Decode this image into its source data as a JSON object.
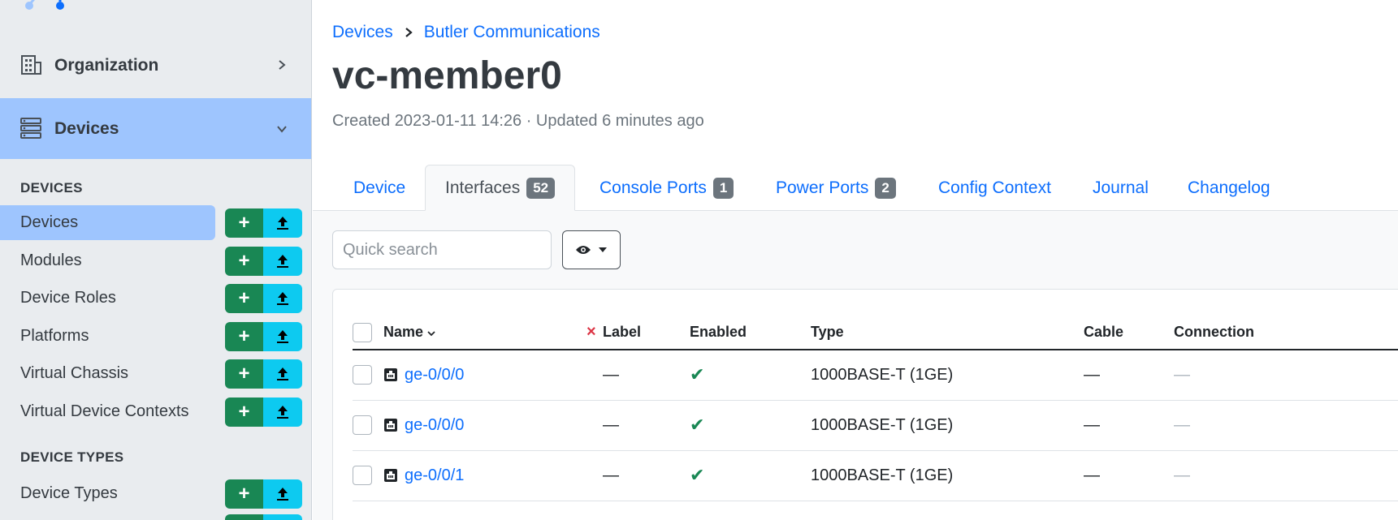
{
  "sidebar": {
    "groups": {
      "organization": "Organization",
      "devices": "Devices"
    },
    "sections": [
      {
        "heading": "DEVICES"
      },
      {
        "heading": "DEVICE TYPES"
      }
    ],
    "items": [
      {
        "label": "Devices",
        "active": true
      },
      {
        "label": "Modules"
      },
      {
        "label": "Device Roles"
      },
      {
        "label": "Platforms"
      },
      {
        "label": "Virtual Chassis"
      },
      {
        "label": "Virtual Device Contexts"
      },
      {
        "label": "Device Types"
      }
    ],
    "add_symbol": "+"
  },
  "breadcrumb": {
    "root": "Devices",
    "current": "Butler Communications"
  },
  "page": {
    "title": "vc-member0",
    "meta": "Created 2023-01-11 14:26 · Updated 6 minutes ago"
  },
  "tabs": [
    {
      "label": "Device"
    },
    {
      "label": "Interfaces",
      "count": "52",
      "active": true
    },
    {
      "label": "Console Ports",
      "count": "1"
    },
    {
      "label": "Power Ports",
      "count": "2"
    },
    {
      "label": "Config Context"
    },
    {
      "label": "Journal"
    },
    {
      "label": "Changelog"
    }
  ],
  "search": {
    "placeholder": "Quick search"
  },
  "table": {
    "columns": {
      "name": "Name",
      "label": "Label",
      "enabled": "Enabled",
      "type": "Type",
      "cable": "Cable",
      "connection": "Connection"
    },
    "rows": [
      {
        "name": "ge-0/0/0",
        "label": "—",
        "enabled": "✔",
        "type": "1000BASE-T (1GE)",
        "cable": "—",
        "connection": "—"
      },
      {
        "name": "ge-0/0/0",
        "label": "—",
        "enabled": "✔",
        "type": "1000BASE-T (1GE)",
        "cable": "—",
        "connection": "—"
      },
      {
        "name": "ge-0/0/1",
        "label": "—",
        "enabled": "✔",
        "type": "1000BASE-T (1GE)",
        "cable": "—",
        "connection": "—"
      }
    ],
    "clear_sort": "×"
  },
  "colors": {
    "primary": "#0d6efd",
    "success": "#198754",
    "info": "#0dcaf0",
    "active_bg": "#9ec5fe",
    "sidebar_bg": "#e9ecef"
  }
}
